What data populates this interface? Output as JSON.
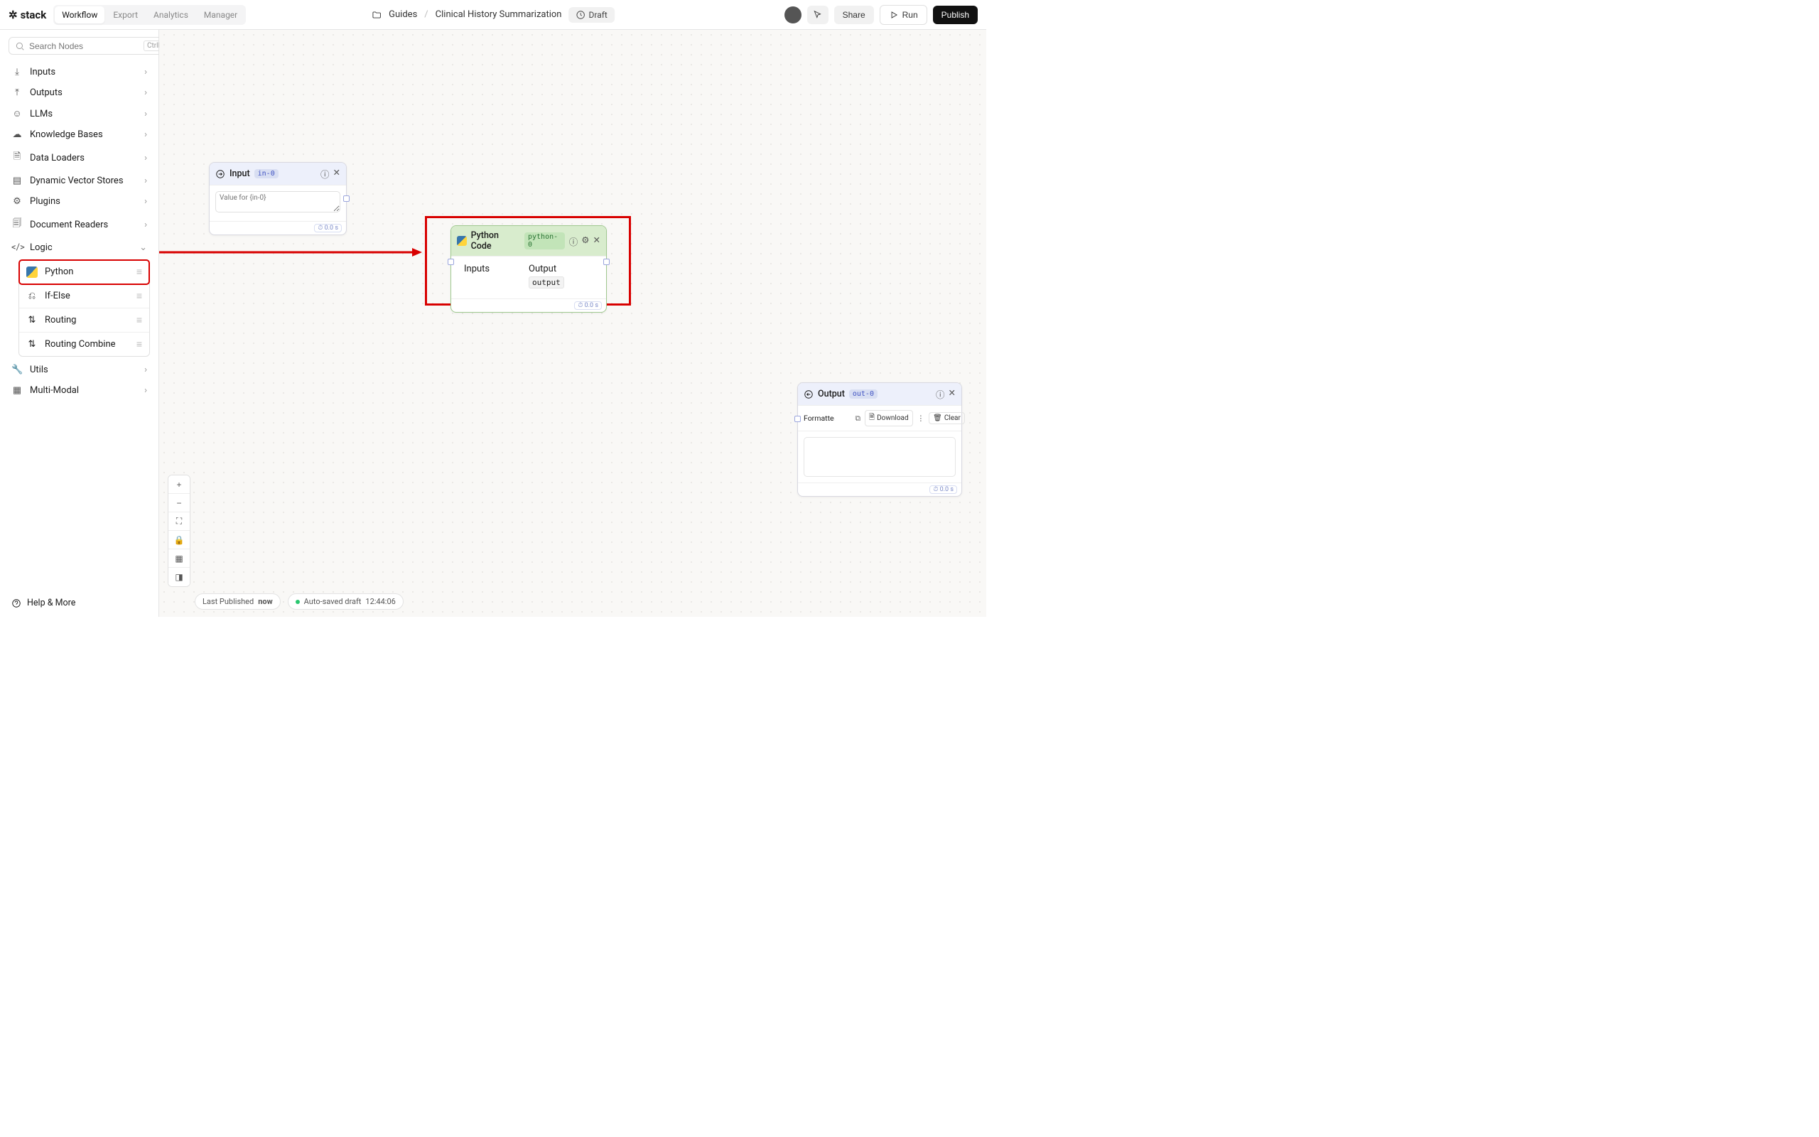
{
  "brand": "stack",
  "nav": {
    "items": [
      {
        "label": "Workflow",
        "active": true
      },
      {
        "label": "Export",
        "active": false
      },
      {
        "label": "Analytics",
        "active": false
      },
      {
        "label": "Manager",
        "active": false
      }
    ]
  },
  "breadcrumb": {
    "folder": "Guides",
    "page": "Clinical History Summarization",
    "status": "Draft"
  },
  "topbar_buttons": {
    "share": "Share",
    "run": "Run",
    "publish": "Publish"
  },
  "search": {
    "placeholder": "Search Nodes",
    "kbd": "CtrlK"
  },
  "categories": [
    {
      "label": "Inputs",
      "icon": "download"
    },
    {
      "label": "Outputs",
      "icon": "upload"
    },
    {
      "label": "LLMs",
      "icon": "chat"
    },
    {
      "label": "Knowledge Bases",
      "icon": "cloud"
    },
    {
      "label": "Data Loaders",
      "icon": "file"
    },
    {
      "label": "Dynamic Vector Stores",
      "icon": "grid"
    },
    {
      "label": "Plugins",
      "icon": "gear"
    },
    {
      "label": "Document Readers",
      "icon": "doc"
    },
    {
      "label": "Logic",
      "icon": "code",
      "open": true
    },
    {
      "label": "Utils",
      "icon": "wrench"
    },
    {
      "label": "Multi-Modal",
      "icon": "grid4"
    }
  ],
  "logic_items": [
    {
      "label": "Python",
      "icon": "python",
      "highlight": true
    },
    {
      "label": "If-Else",
      "icon": "branch"
    },
    {
      "label": "Routing",
      "icon": "swap"
    },
    {
      "label": "Routing Combine",
      "icon": "swap"
    }
  ],
  "nodes": {
    "input": {
      "title": "Input",
      "tag": "in-0",
      "placeholder": "Value for {in-0}",
      "time": "0.0 s"
    },
    "python": {
      "title": "Python Code",
      "tag": "python-0",
      "col_inputs": "Inputs",
      "col_output": "Output",
      "output_var": "output",
      "time": "0.0 s"
    },
    "output": {
      "title": "Output",
      "tag": "out-0",
      "formatted": "Formatted",
      "download": "Download",
      "clear": "Clear",
      "time": "0.0 s"
    }
  },
  "footer": {
    "help": "Help & More"
  },
  "status": {
    "last_published_label": "Last Published",
    "last_published_value": "now",
    "autosave_label": "Auto-saved draft",
    "autosave_time": "12:44:06"
  }
}
